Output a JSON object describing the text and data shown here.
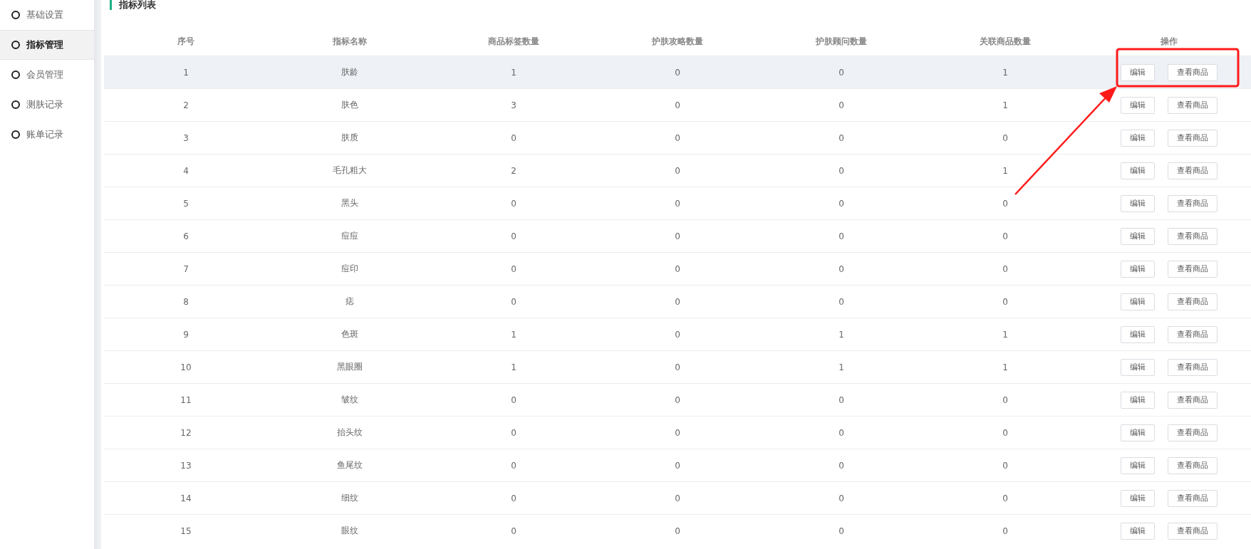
{
  "sidebar": {
    "items": [
      {
        "label": "基础设置",
        "selected": false
      },
      {
        "label": "指标管理",
        "selected": true
      },
      {
        "label": "会员管理",
        "selected": false
      },
      {
        "label": "测肤记录",
        "selected": false
      },
      {
        "label": "账单记录",
        "selected": false
      }
    ]
  },
  "section_title": "指标列表",
  "table": {
    "columns": [
      "序号",
      "指标名称",
      "商品标签数量",
      "护肤攻略数量",
      "护肤顾问数量",
      "关联商品数量",
      "操作"
    ],
    "rows": [
      {
        "cells": [
          "1",
          "肤龄",
          "1",
          "0",
          "0",
          "1"
        ],
        "actions": [
          "编辑",
          "查看商品"
        ],
        "selected": true
      },
      {
        "cells": [
          "2",
          "肤色",
          "3",
          "0",
          "0",
          "1"
        ],
        "actions": [
          "编辑",
          "查看商品"
        ],
        "selected": false
      },
      {
        "cells": [
          "3",
          "肤质",
          "0",
          "0",
          "0",
          "0"
        ],
        "actions": [
          "编辑",
          "查看商品"
        ],
        "selected": false
      },
      {
        "cells": [
          "4",
          "毛孔粗大",
          "2",
          "0",
          "0",
          "1"
        ],
        "actions": [
          "编辑",
          "查看商品"
        ],
        "selected": false
      },
      {
        "cells": [
          "5",
          "黑头",
          "0",
          "0",
          "0",
          "0"
        ],
        "actions": [
          "编辑",
          "查看商品"
        ],
        "selected": false
      },
      {
        "cells": [
          "6",
          "痘痘",
          "0",
          "0",
          "0",
          "0"
        ],
        "actions": [
          "编辑",
          "查看商品"
        ],
        "selected": false
      },
      {
        "cells": [
          "7",
          "痘印",
          "0",
          "0",
          "0",
          "0"
        ],
        "actions": [
          "编辑",
          "查看商品"
        ],
        "selected": false
      },
      {
        "cells": [
          "8",
          "痣",
          "0",
          "0",
          "0",
          "0"
        ],
        "actions": [
          "编辑",
          "查看商品"
        ],
        "selected": false
      },
      {
        "cells": [
          "9",
          "色斑",
          "1",
          "0",
          "1",
          "1"
        ],
        "actions": [
          "编辑",
          "查看商品"
        ],
        "selected": false
      },
      {
        "cells": [
          "10",
          "黑眼圈",
          "1",
          "0",
          "1",
          "1"
        ],
        "actions": [
          "编辑",
          "查看商品"
        ],
        "selected": false
      },
      {
        "cells": [
          "11",
          "皱纹",
          "0",
          "0",
          "0",
          "0"
        ],
        "actions": [
          "编辑",
          "查看商品"
        ],
        "selected": false
      },
      {
        "cells": [
          "12",
          "抬头纹",
          "0",
          "0",
          "0",
          "0"
        ],
        "actions": [
          "编辑",
          "查看商品"
        ],
        "selected": false
      },
      {
        "cells": [
          "13",
          "鱼尾纹",
          "0",
          "0",
          "0",
          "0"
        ],
        "actions": [
          "编辑",
          "查看商品"
        ],
        "selected": false
      },
      {
        "cells": [
          "14",
          "细纹",
          "0",
          "0",
          "0",
          "0"
        ],
        "actions": [
          "编辑",
          "查看商品"
        ],
        "selected": false
      },
      {
        "cells": [
          "15",
          "眼纹",
          "0",
          "0",
          "0",
          "0"
        ],
        "actions": [
          "编辑",
          "查看商品"
        ],
        "selected": false
      }
    ]
  }
}
